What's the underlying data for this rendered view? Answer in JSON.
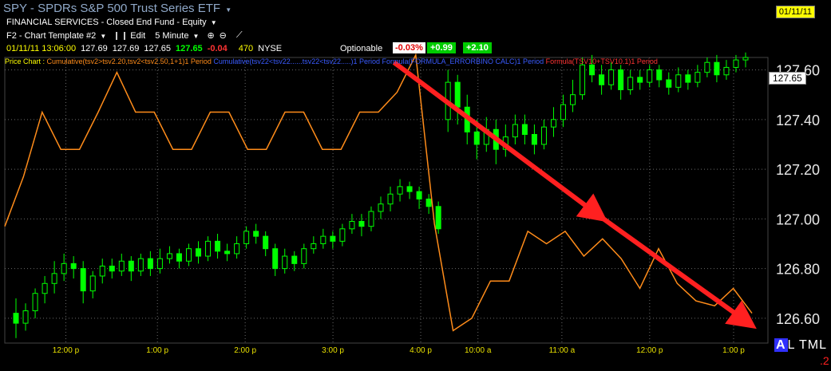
{
  "header": {
    "title": "SPY - SPDRs S&P 500 Trust Series ETF",
    "title_caret": "▼",
    "date_badge": "01/11/11",
    "sector": "FINANCIAL SERVICES - Closed End Fund - Equity",
    "sector_caret": "▼"
  },
  "toolbar": {
    "template": "F2 - Chart Template #2",
    "edit_label": "Edit",
    "interval": "5 Minute",
    "caret": "▼"
  },
  "quote": {
    "datetime": "01/11/11 13:06:00",
    "open": "127.69",
    "high": "127.69",
    "low": "127.65",
    "last": "127.65",
    "change": "-0.04",
    "volume": "470",
    "exchange": "NYSE",
    "optionable": "Optionable",
    "pct_change": "-0.03%",
    "pos1": "+0.99",
    "pos2": "+2.10"
  },
  "legend": {
    "price_chart": "Price Chart :",
    "item1": "Cumulative(tsv2>tsv2.20,tsv2<tsv2.50,1+1)1 Period",
    "item2": "Cumulative(tsv22<tsv22......tsv22<tsv22.....)1 Period",
    "item3": "Formula(FORMULA_ERRORBINO CALC)1 Period",
    "item4": "Formula(TSV10+TSV10.1)1 Period"
  },
  "price_tag": "127.65",
  "y_axis": [
    "127.60",
    "127.40",
    "127.20",
    "127.00",
    "126.80",
    "126.60"
  ],
  "x_axis": [
    "12:00 p",
    "1:00 p",
    "2:00 p",
    "3:00 p",
    "4:00 p",
    "10:00 a",
    "11:00 a",
    "12:00 p",
    "1:00 p"
  ],
  "corner": {
    "a": "A",
    "rest": "L TML",
    "num": ".2"
  },
  "colors": {
    "up": "#00ff00",
    "down": "#00ff00",
    "indicator": "#ff8c1a",
    "arrow": "#ff2020",
    "grid": "#6a6a6a"
  },
  "chart_data": {
    "type": "candlestick",
    "ylim": [
      126.5,
      127.65
    ],
    "candles": [
      [
        126.62,
        126.58,
        126.52,
        126.68
      ],
      [
        126.58,
        126.63,
        126.55,
        126.66
      ],
      [
        126.63,
        126.7,
        126.6,
        126.72
      ],
      [
        126.7,
        126.74,
        126.66,
        126.77
      ],
      [
        126.74,
        126.78,
        126.7,
        126.83
      ],
      [
        126.78,
        126.82,
        126.75,
        126.86
      ],
      [
        126.82,
        126.8,
        126.76,
        126.85
      ],
      [
        126.8,
        126.71,
        126.66,
        126.83
      ],
      [
        126.71,
        126.77,
        126.68,
        126.79
      ],
      [
        126.77,
        126.81,
        126.74,
        126.84
      ],
      [
        126.81,
        126.79,
        126.76,
        126.84
      ],
      [
        126.79,
        126.83,
        126.77,
        126.86
      ],
      [
        126.83,
        126.79,
        126.75,
        126.85
      ],
      [
        126.79,
        126.84,
        126.77,
        126.86
      ],
      [
        126.84,
        126.8,
        126.77,
        126.87
      ],
      [
        126.8,
        126.84,
        126.78,
        126.88
      ],
      [
        126.84,
        126.86,
        126.82,
        126.89
      ],
      [
        126.86,
        126.83,
        126.8,
        126.88
      ],
      [
        126.83,
        126.88,
        126.81,
        126.9
      ],
      [
        126.88,
        126.85,
        126.82,
        126.91
      ],
      [
        126.85,
        126.91,
        126.83,
        126.93
      ],
      [
        126.91,
        126.87,
        126.84,
        126.94
      ],
      [
        126.87,
        126.86,
        126.83,
        126.9
      ],
      [
        126.86,
        126.9,
        126.84,
        126.93
      ],
      [
        126.9,
        126.95,
        126.88,
        126.97
      ],
      [
        126.95,
        126.93,
        126.9,
        126.98
      ],
      [
        126.93,
        126.88,
        126.85,
        126.95
      ],
      [
        126.88,
        126.8,
        126.77,
        126.9
      ],
      [
        126.8,
        126.85,
        126.78,
        126.88
      ],
      [
        126.85,
        126.82,
        126.79,
        126.87
      ],
      [
        126.82,
        126.88,
        126.8,
        126.9
      ],
      [
        126.88,
        126.9,
        126.86,
        126.93
      ],
      [
        126.9,
        126.93,
        126.88,
        126.96
      ],
      [
        126.93,
        126.91,
        126.88,
        126.95
      ],
      [
        126.91,
        126.96,
        126.89,
        126.98
      ],
      [
        126.96,
        126.99,
        126.94,
        127.02
      ],
      [
        126.99,
        126.97,
        126.93,
        127.02
      ],
      [
        126.97,
        127.03,
        126.95,
        127.05
      ],
      [
        127.03,
        127.06,
        127.0,
        127.09
      ],
      [
        127.06,
        127.1,
        127.03,
        127.13
      ],
      [
        127.1,
        127.13,
        127.07,
        127.16
      ],
      [
        127.13,
        127.11,
        127.08,
        127.15
      ],
      [
        127.11,
        127.08,
        127.04,
        127.13
      ],
      [
        127.08,
        127.05,
        127.02,
        127.1
      ],
      [
        127.05,
        126.96,
        126.94,
        127.07
      ],
      [
        127.4,
        127.55,
        127.35,
        127.6
      ],
      [
        127.55,
        127.45,
        127.38,
        127.58
      ],
      [
        127.45,
        127.35,
        127.3,
        127.5
      ],
      [
        127.35,
        127.3,
        127.24,
        127.4
      ],
      [
        127.3,
        127.36,
        127.27,
        127.41
      ],
      [
        127.36,
        127.28,
        127.22,
        127.4
      ],
      [
        127.28,
        127.33,
        127.25,
        127.38
      ],
      [
        127.33,
        127.38,
        127.3,
        127.42
      ],
      [
        127.38,
        127.34,
        127.3,
        127.42
      ],
      [
        127.34,
        127.3,
        127.26,
        127.38
      ],
      [
        127.3,
        127.37,
        127.28,
        127.4
      ],
      [
        127.37,
        127.4,
        127.33,
        127.45
      ],
      [
        127.4,
        127.46,
        127.37,
        127.5
      ],
      [
        127.46,
        127.5,
        127.43,
        127.56
      ],
      [
        127.5,
        127.62,
        127.48,
        127.65
      ],
      [
        127.62,
        127.58,
        127.55,
        127.66
      ],
      [
        127.58,
        127.54,
        127.5,
        127.62
      ],
      [
        127.54,
        127.6,
        127.52,
        127.63
      ],
      [
        127.6,
        127.52,
        127.48,
        127.62
      ],
      [
        127.52,
        127.57,
        127.5,
        127.6
      ],
      [
        127.57,
        127.55,
        127.52,
        127.6
      ],
      [
        127.55,
        127.6,
        127.53,
        127.62
      ],
      [
        127.6,
        127.56,
        127.53,
        127.62
      ],
      [
        127.56,
        127.53,
        127.5,
        127.59
      ],
      [
        127.53,
        127.58,
        127.51,
        127.61
      ],
      [
        127.58,
        127.55,
        127.52,
        127.6
      ],
      [
        127.55,
        127.59,
        127.53,
        127.62
      ],
      [
        127.59,
        127.63,
        127.57,
        127.65
      ],
      [
        127.63,
        127.58,
        127.55,
        127.66
      ],
      [
        127.58,
        127.61,
        127.56,
        127.64
      ],
      [
        127.61,
        127.64,
        127.59,
        127.66
      ],
      [
        127.64,
        127.65,
        127.61,
        127.67
      ]
    ],
    "indicator": [
      126.97,
      127.17,
      127.43,
      127.28,
      127.28,
      127.43,
      127.59,
      127.43,
      127.43,
      127.28,
      127.28,
      127.43,
      127.43,
      127.28,
      127.28,
      127.43,
      127.43,
      127.28,
      127.28,
      127.43,
      127.43,
      127.51,
      127.66,
      126.98,
      126.55,
      126.6,
      126.75,
      126.75,
      126.95,
      126.9,
      126.95,
      126.85,
      126.92,
      126.84,
      126.72,
      126.88,
      126.74,
      126.67,
      126.65,
      126.72,
      126.62
    ],
    "arrows": [
      {
        "from": [
          0.51,
          127.63
        ],
        "to": [
          0.78,
          127.01
        ]
      },
      {
        "from": [
          0.78,
          127.01
        ],
        "to": [
          0.975,
          126.58
        ]
      }
    ]
  }
}
